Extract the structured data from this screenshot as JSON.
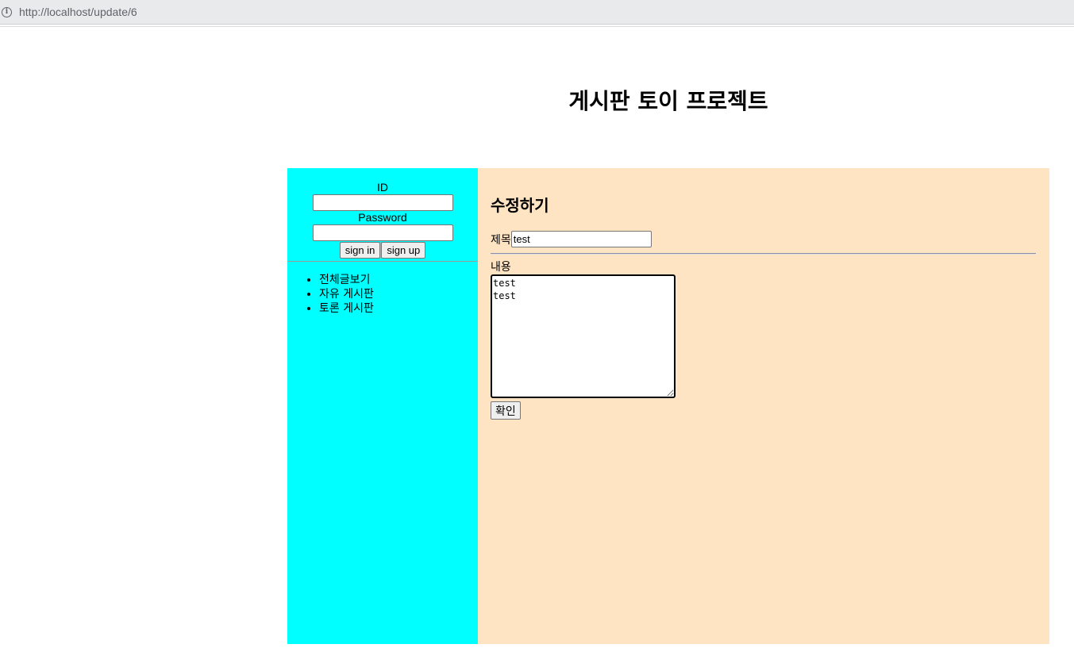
{
  "browser": {
    "url": "http://localhost/update/6"
  },
  "header": {
    "title": "게시판 토이 프로젝트"
  },
  "sidebar": {
    "login": {
      "id_label": "ID",
      "id_value": "",
      "password_label": "Password",
      "password_value": "",
      "signin_label": "sign in",
      "signup_label": "sign up"
    },
    "menu": [
      {
        "label": "전체글보기"
      },
      {
        "label": "자유 게시판"
      },
      {
        "label": "토론 게시판"
      }
    ]
  },
  "main": {
    "heading": "수정하기",
    "title_label": "제목",
    "title_value": "test",
    "content_label": "내용",
    "content_value": "test\ntest",
    "submit_label": "확인"
  },
  "colors": {
    "sidebar_bg": "#00ffff",
    "main_bg": "#ffe4c4"
  }
}
